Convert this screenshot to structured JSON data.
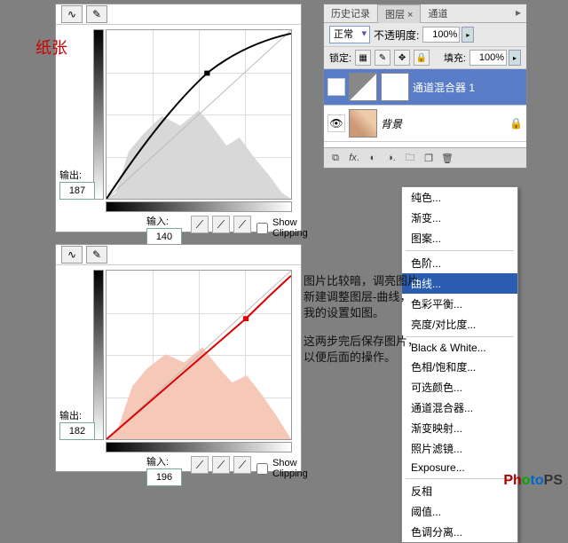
{
  "curves": {
    "show_clipping_label": "Show Clipping",
    "output_label": "输出:",
    "input_label": "输入:",
    "panel1": {
      "output": "187",
      "input": "140",
      "histo_color": "#d8d8d8",
      "curve_color": "#000"
    },
    "panel2": {
      "output": "182",
      "input": "196",
      "histo_color": "#f5c8b8",
      "curve_color": "#d00"
    }
  },
  "layers": {
    "tabs": {
      "history": "历史记录",
      "layers": "图层 ×",
      "channels": "通道"
    },
    "blend_mode": "正常",
    "opacity_label": "不透明度:",
    "opacity_value": "100%",
    "lock_label": "锁定:",
    "fill_label": "填充:",
    "fill_value": "100%",
    "layer_adj": "通道混合器 1",
    "layer_bg": "背景"
  },
  "menu": {
    "items": [
      [
        "纯色...",
        "渐变...",
        "图案..."
      ],
      [
        "色阶...",
        "曲线...",
        "色彩平衡...",
        "亮度/对比度..."
      ],
      [
        "Black & White...",
        "色相/饱和度...",
        "可选颜色...",
        "通道混合器...",
        "渐变映射...",
        "照片滤镜...",
        "Exposure..."
      ],
      [
        "反相",
        "阈值...",
        "色调分离..."
      ]
    ],
    "highlight": "曲线..."
  },
  "annotations": {
    "line1": "图片比较暗，调亮图片",
    "line2": "新建调整图层-曲线，",
    "line3": "我的设置如图。",
    "line4": "这两步完后保存图片，",
    "line5": "以便后面的操作。"
  },
  "watermark": "PhotoPS",
  "zhizhang": "纸张"
}
